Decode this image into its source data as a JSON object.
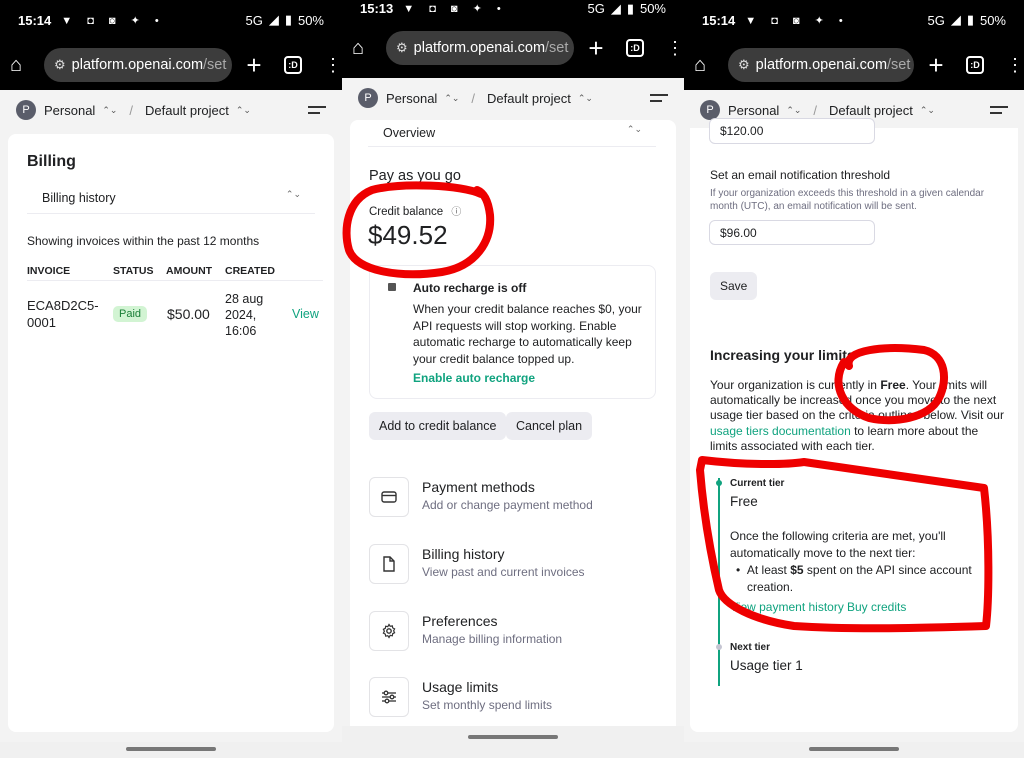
{
  "panels": [
    {
      "status": {
        "time": "15:14",
        "network": "5G",
        "battery": "50%"
      },
      "browser": {
        "url_main": "platform.openai.com",
        "url_path": "/set",
        "tabs_label": ":D"
      },
      "nav": {
        "avatar": "P",
        "org": "Personal",
        "project": "Default project"
      },
      "billing": {
        "title": "Billing",
        "select_value": "Billing history",
        "note": "Showing invoices within the past 12 months",
        "columns": [
          "INVOICE",
          "STATUS",
          "AMOUNT",
          "CREATED"
        ],
        "row": {
          "invoice_line1": "ECA8D2C5-",
          "invoice_line2": "0001",
          "status": "Paid",
          "amount": "$50.00",
          "created_line1": "28 aug",
          "created_line2": "2024,",
          "created_line3": "16:06",
          "action": "View"
        }
      }
    },
    {
      "status": {
        "time": "15:13",
        "network": "5G",
        "battery": "50%"
      },
      "browser": {
        "url_main": "platform.openai.com",
        "url_path": "/set",
        "tabs_label": ":D"
      },
      "nav": {
        "avatar": "P",
        "org": "Personal",
        "project": "Default project"
      },
      "overview": {
        "select_value": "Overview",
        "section_title": "Pay as you go",
        "credit_label": "Credit balance",
        "credit_value": "$49.52",
        "recharge_title": "Auto recharge is off",
        "recharge_line1": "When your credit balance reaches $0, your",
        "recharge_line2": "API requests will stop working. Enable",
        "recharge_line3": "automatic recharge to automatically keep",
        "recharge_line4": "your credit balance topped up.",
        "recharge_link": "Enable auto recharge",
        "add_button": "Add to credit balance",
        "cancel_button": "Cancel plan",
        "items": [
          {
            "title": "Payment methods",
            "subtitle": "Add or change payment method",
            "icon": "credit-card-icon"
          },
          {
            "title": "Billing history",
            "subtitle": "View past and current invoices",
            "icon": "document-icon"
          },
          {
            "title": "Preferences",
            "subtitle": "Manage billing information",
            "icon": "gear-icon"
          },
          {
            "title": "Usage limits",
            "subtitle": "Set monthly spend limits",
            "icon": "sliders-icon"
          }
        ]
      }
    },
    {
      "status": {
        "time": "15:14",
        "network": "5G",
        "battery": "50%"
      },
      "browser": {
        "url_main": "platform.openai.com",
        "url_path": "/set",
        "tabs_label": ":D"
      },
      "nav": {
        "avatar": "P",
        "org": "Personal",
        "project": "Default project"
      },
      "limits": {
        "partial_value": "$120.00",
        "email_title": "Set an email notification threshold",
        "email_desc_line1": "If your organization exceeds this threshold in a given calendar",
        "email_desc_line2": "month (UTC), an email notification will be sent.",
        "email_value": "$96.00",
        "save_button": "Save",
        "inc_title": "Increasing your limits",
        "inc_l1a": "Your organization is currently in ",
        "inc_l1b": "Free",
        "inc_l1c": ". Your limits will",
        "inc_l2": "automatically be increased once you move to the next",
        "inc_l3": "usage tier based on the criteria outlined below. Visit our",
        "inc_link": "usage tiers documentation",
        "inc_l4b": " to learn more about the",
        "inc_l5": "limits associated with each tier.",
        "current_tier_label": "Current tier",
        "current_tier": "Free",
        "criteria_l1": "Once the following criteria are met, you'll",
        "criteria_l2": "automatically move to the next tier:",
        "bullet_a": "At least ",
        "bullet_b": "$5",
        "bullet_c": " spent on the API since account",
        "bullet_l2": "creation.",
        "link_payment": "View payment history",
        "link_buy": "Buy credits",
        "next_tier_label": "Next tier",
        "next_tier": "Usage tier 1"
      }
    }
  ],
  "colors": {
    "accent": "#10a37f",
    "annotation": "#ee0000"
  }
}
